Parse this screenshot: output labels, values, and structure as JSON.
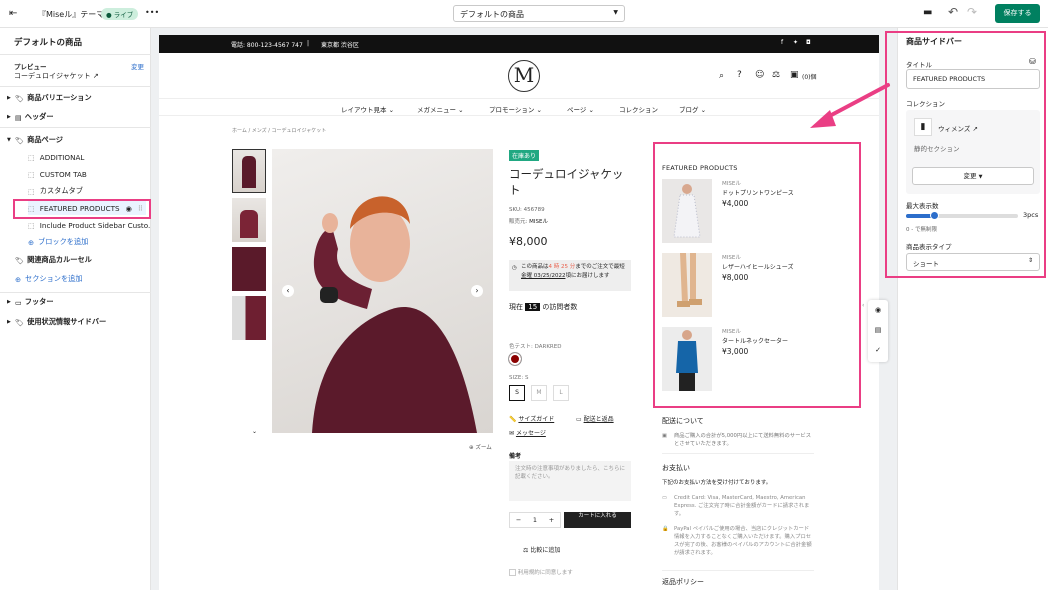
{
  "topbar": {
    "theme_title": "『Miseル』テーマ",
    "live_badge": "ライブ",
    "more": "•••",
    "template_select": "デフォルトの商品",
    "save": "保存する"
  },
  "sidebar": {
    "title": "デフォルトの商品",
    "preview_label": "プレビュー",
    "preview_change": "変更",
    "preview_item": "コーデュロイジャケット",
    "variations": "商品バリエーション",
    "header": "ヘッダー",
    "product_page": "商品ページ",
    "blocks": [
      "ADDITIONAL",
      "CUSTOM TAB",
      "カスタムタブ",
      "FEATURED PRODUCTS",
      "Include Product Sidebar Custo..."
    ],
    "add_block": "ブロックを追加",
    "related": "関連商品カルーセル",
    "add_section": "セクションを追加",
    "footer": "フッター",
    "usage_sidebar": "使用状況情報サイドバー"
  },
  "store": {
    "announce_phone": "電話: 800-123-4567 747",
    "announce_sep": "|",
    "announce_addr": "東京都 渋谷区",
    "logo": "M",
    "cart_count": "(0)個",
    "nav": [
      "レイアウト見本",
      "メガメニュー",
      "プロモーション",
      "ページ",
      "コレクション",
      "ブログ"
    ],
    "breadcrumb": [
      "ホーム",
      "メンズ",
      "コーデュロイジャケット"
    ],
    "stock": "在庫あり",
    "name_line1": "コーデュロイジャケッ",
    "name_line2": "ト",
    "sku": "SKU: 456789",
    "vendor_label": "販売元:",
    "vendor": "MISEル",
    "price": "¥8,000",
    "notice_pre": "この商品は",
    "notice_time": "4 時 25 分",
    "notice_mid": "までのご注文で最短",
    "notice_date": "金曜 03/25/2022",
    "notice_post": "頃にお届けします",
    "visitors_pre": "現在",
    "visitors_num": "15",
    "visitors_post": "の訪問者数",
    "color_label": "色テスト: DARKRED",
    "size_label": "SIZE: S",
    "sizes": [
      "S",
      "M",
      "L"
    ],
    "size_guide": "サイズガイド",
    "shipping": "配送と返品",
    "message": "メッセージ",
    "notes_label": "備考",
    "notes_placeholder": "注文時の注意事項がありましたら、こちらに記載ください。",
    "qty": "1",
    "minus": "−",
    "plus": "+",
    "add_to_cart": "カートに入れる",
    "compare": "比較に追加",
    "agree": "利用規約に同意します",
    "zoom": "ズーム",
    "featured_title": "FEATURED PRODUCTS",
    "featured": [
      {
        "vendor": "MISEル",
        "name": "ドットプリントワンピース",
        "price": "¥4,000"
      },
      {
        "vendor": "MISEル",
        "name": "レザーハイヒールシューズ",
        "price": "¥8,000"
      },
      {
        "vendor": "MISEル",
        "name": "タートルネックセーター",
        "price": "¥3,000"
      }
    ],
    "delivery_title": "配送について",
    "delivery_text": "商品ご購入の合計が5,000円以上にて送料無料のサービスとさせていただきます。",
    "payment_title": "お支払い",
    "payment_sub": "下記のお支払い方法を受け付けております。",
    "payment_card": "Credit Card: Visa, MasterCard, Maestro, American Express. ご注文完了時に合計金額がカードに請求されます。",
    "payment_paypal": "PayPal ペイパルご使用の場合、当店にクレジットカード情報を入力することなくご購入いただけます。購入プロセスが完了の後、お客様のペイパルのアカウントに合計金額が請求されます。",
    "returns_title": "返品ポリシー"
  },
  "rightpanel": {
    "title": "商品サイドバー",
    "title_label": "タイトル",
    "title_value": "FEATURED PRODUCTS",
    "collection_label": "コレクション",
    "collection_name": "ウィメンズ",
    "static_section": "静的セクション",
    "change": "変更",
    "max_label": "最大表示数",
    "max_value": "3pcs",
    "unlimited": "0 - で無制限",
    "max_fraction": 0.25,
    "type_label": "商品表示タイプ",
    "type_value": "ショート"
  },
  "colors": {
    "accent": "#ea3e84",
    "primary": "#008060",
    "black": "#111111"
  }
}
